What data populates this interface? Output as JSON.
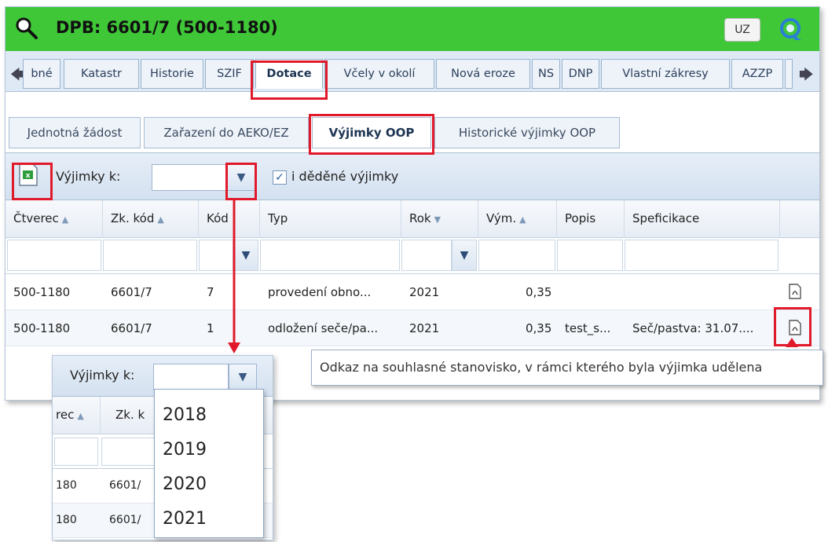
{
  "window": {
    "title": "DPB: 6601/7 (500-1180)",
    "uz_label": "UZ",
    "search_icon": "search-icon",
    "refresh_icon": "refresh-icon"
  },
  "tabs": [
    {
      "label": "bné"
    },
    {
      "label": "Katastr"
    },
    {
      "label": "Historie"
    },
    {
      "label": "SZIF"
    },
    {
      "label": "Dotace",
      "active": true
    },
    {
      "label": "Včely v okolí"
    },
    {
      "label": "Nová eroze"
    },
    {
      "label": "NS"
    },
    {
      "label": "DNP"
    },
    {
      "label": "Vlastní zákresy"
    },
    {
      "label": "AZZP"
    }
  ],
  "subtabs": [
    {
      "label": "Jednotná žádost"
    },
    {
      "label": "Zařazení do AEKO/EZ"
    },
    {
      "label": "Výjimky OOP",
      "active": true
    },
    {
      "label": "Historické výjimky OOP"
    }
  ],
  "toolbar": {
    "label": "Výjimky k:",
    "year_value": "",
    "checkbox_label": "i děděné výjimky",
    "checkbox_checked": true
  },
  "grid": {
    "columns": [
      "Čtverec",
      "Zk. kód",
      "Kód",
      "Typ",
      "Rok",
      "Vým.",
      "Popis",
      "Speficikace"
    ],
    "rows": [
      {
        "ctverec": "500-1180",
        "zk_kod": "6601/7",
        "kod": "7",
        "typ": "provedení obno...",
        "rok": "2021",
        "vym": "0,35",
        "popis": "",
        "specifikace": ""
      },
      {
        "ctverec": "500-1180",
        "zk_kod": "6601/7",
        "kod": "1",
        "typ": "odložení seče/pa...",
        "rok": "2021",
        "vym": "0,35",
        "popis": "test_s...",
        "specifikace": "Seč/pastva: 31.07...."
      }
    ]
  },
  "tooltip": {
    "text": "Odkaz na souhlasné stanovisko, v rámci kterého byla výjimka udělena"
  },
  "inset": {
    "label": "Výjimky k:",
    "col_a": "rec",
    "col_b": "Zk. k",
    "rows": [
      {
        "a": "180",
        "b": "6601/"
      },
      {
        "a": "180",
        "b": "6601/"
      }
    ],
    "years": [
      "2018",
      "2019",
      "2020",
      "2021"
    ]
  },
  "colors": {
    "title_bar": "#3fc738",
    "highlight": "#e0192b"
  }
}
